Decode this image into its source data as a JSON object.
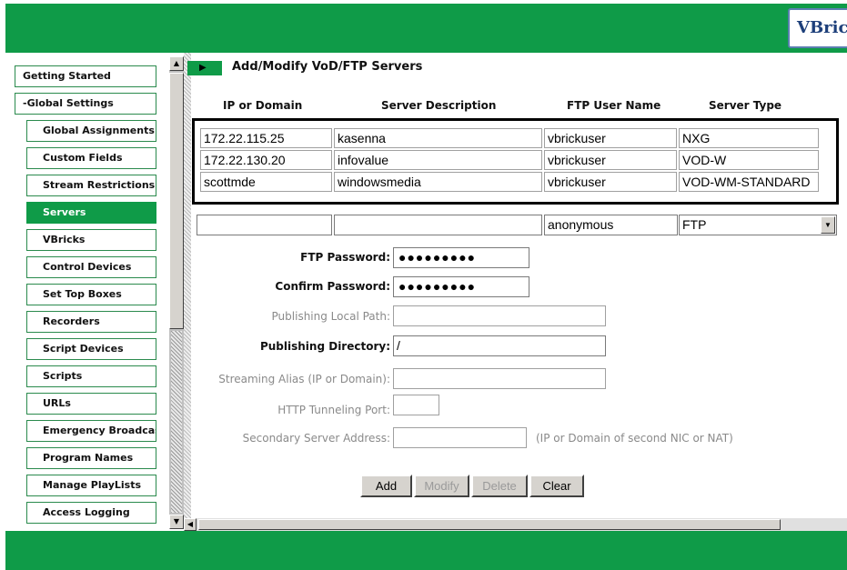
{
  "brand": {
    "logo_text": "VBric"
  },
  "sidebar": {
    "items": [
      {
        "label": "Getting Started",
        "level": "top",
        "active": false
      },
      {
        "label": "-Global Settings",
        "level": "top",
        "active": false
      },
      {
        "label": "Global Assignments",
        "level": "sub",
        "active": false
      },
      {
        "label": "Custom Fields",
        "level": "sub",
        "active": false
      },
      {
        "label": "Stream Restrictions",
        "level": "sub",
        "active": false
      },
      {
        "label": "Servers",
        "level": "sub",
        "active": true
      },
      {
        "label": "VBricks",
        "level": "sub",
        "active": false
      },
      {
        "label": "Control Devices",
        "level": "sub",
        "active": false
      },
      {
        "label": "Set Top Boxes",
        "level": "sub",
        "active": false
      },
      {
        "label": "Recorders",
        "level": "sub",
        "active": false
      },
      {
        "label": "Script Devices",
        "level": "sub",
        "active": false
      },
      {
        "label": "Scripts",
        "level": "sub",
        "active": false
      },
      {
        "label": "URLs",
        "level": "sub",
        "active": false
      },
      {
        "label": "Emergency Broadcast",
        "level": "sub",
        "active": false
      },
      {
        "label": "Program Names",
        "level": "sub",
        "active": false
      },
      {
        "label": "Manage PlayLists",
        "level": "sub",
        "active": false
      },
      {
        "label": "Access Logging",
        "level": "sub",
        "active": false
      }
    ]
  },
  "main": {
    "title": "Add/Modify VoD/FTP Servers",
    "columns": [
      "IP or Domain",
      "Server Description",
      "FTP User Name",
      "Server Type"
    ],
    "servers": [
      [
        "172.22.115.25",
        "kasenna",
        "vbrickuser",
        "NXG"
      ],
      [
        "172.22.130.20",
        "infovalue",
        "vbrickuser",
        "VOD-W"
      ],
      [
        "scottmde",
        "windowsmedia",
        "vbrickuser",
        "VOD-WM-STANDARD"
      ]
    ],
    "new_entry": {
      "ip": "",
      "description": "",
      "ftp_user": "anonymous",
      "server_type": "FTP"
    },
    "form": {
      "ftp_password_label": "FTP Password:",
      "ftp_password_value": "●●●●●●●●●",
      "confirm_password_label": "Confirm Password:",
      "confirm_password_value": "●●●●●●●●●",
      "publishing_local_path_label": "Publishing Local Path:",
      "publishing_local_path_value": "",
      "publishing_directory_label": "Publishing Directory:",
      "publishing_directory_value": "/",
      "streaming_alias_label": "Streaming Alias (IP or Domain):",
      "streaming_alias_value": "",
      "http_tunneling_port_label": "HTTP Tunneling Port:",
      "http_tunneling_port_value": "",
      "secondary_server_label": "Secondary Server Address:",
      "secondary_server_value": "",
      "secondary_server_note": "(IP or Domain of second NIC or NAT)"
    },
    "buttons": {
      "add": "Add",
      "modify": "Modify",
      "delete": "Delete",
      "clear": "Clear"
    }
  },
  "colors": {
    "brand_green": "#0f9b48",
    "border_green": "#2a8a4d",
    "disabled_gray": "#8a8a8a"
  }
}
